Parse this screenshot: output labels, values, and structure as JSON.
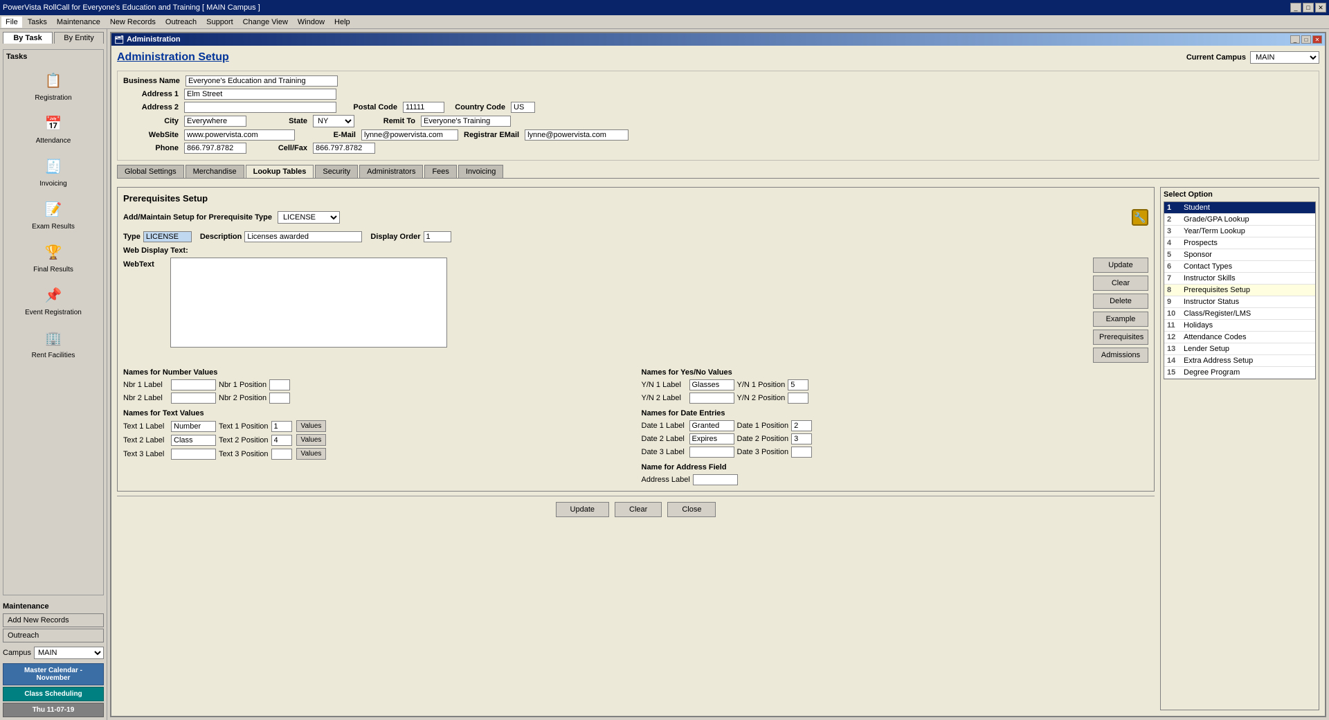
{
  "titlebar": {
    "title": "PowerVista RollCall for Everyone's Education and Training   [ MAIN Campus ]",
    "controls": [
      "minimize",
      "maximize",
      "close"
    ]
  },
  "menubar": {
    "items": [
      "File",
      "Tasks",
      "Maintenance",
      "New Records",
      "Outreach",
      "Support",
      "Change View",
      "Window",
      "Help"
    ]
  },
  "sidebar": {
    "tab1": "By Task",
    "tab2": "By Entity",
    "tasks_label": "Tasks",
    "tasks": [
      {
        "id": "registration",
        "label": "Registration",
        "icon": "📋"
      },
      {
        "id": "attendance",
        "label": "Attendance",
        "icon": "📅"
      },
      {
        "id": "invoicing",
        "label": "Invoicing",
        "icon": "🧾"
      },
      {
        "id": "exam-results",
        "label": "Exam Results",
        "icon": "📝"
      },
      {
        "id": "final-results",
        "label": "Final Results",
        "icon": "🏆"
      },
      {
        "id": "event-registration",
        "label": "Event\nRegistration",
        "icon": "📌"
      },
      {
        "id": "rent-facilities",
        "label": "Rent Facilities",
        "icon": "🏢"
      }
    ],
    "maintenance_label": "Maintenance",
    "add_new_records": "Add New Records",
    "outreach": "Outreach",
    "campus_label": "Campus",
    "campus_value": "MAIN",
    "bottom_buttons": [
      {
        "id": "master-calendar",
        "label": "Master Calendar - November",
        "color": "blue"
      },
      {
        "id": "class-scheduling",
        "label": "Class Scheduling",
        "color": "teal"
      },
      {
        "id": "date",
        "label": "Thu 11-07-19",
        "color": "gray"
      }
    ]
  },
  "window": {
    "title": "Administration",
    "controls": [
      "minimize",
      "restore",
      "close"
    ]
  },
  "header": {
    "page_title": "Administration Setup",
    "current_campus_label": "Current Campus",
    "current_campus_value": "MAIN"
  },
  "form": {
    "business_name_label": "Business Name",
    "business_name_value": "Everyone's Education and Training",
    "address1_label": "Address 1",
    "address1_value": "Elm Street",
    "address2_label": "Address 2",
    "address2_value": "",
    "postal_code_label": "Postal Code",
    "postal_code_value": "11111",
    "country_code_label": "Country Code",
    "country_code_value": "US",
    "city_label": "City",
    "city_value": "Everywhere",
    "state_label": "State",
    "state_value": "NY",
    "website_label": "WebSite",
    "website_value": "www.powervista.com",
    "email_label": "E-Mail",
    "email_value": "lynne@powervista.com",
    "registrar_email_label": "Registrar EMail",
    "registrar_email_value": "lynne@powervista.com",
    "phone_label": "Phone",
    "phone_value": "866.797.8782",
    "cellfax_label": "Cell/Fax",
    "cellfax_value": "866.797.8782",
    "remit_to_label": "Remit To",
    "remit_to_value": "Everyone's Training"
  },
  "tabs": {
    "items": [
      "Global Settings",
      "Merchandise",
      "Lookup Tables",
      "Security",
      "Administrators",
      "Fees",
      "Invoicing"
    ],
    "active": "Lookup Tables"
  },
  "prereq_section": {
    "title": "Prerequisites Setup",
    "maintain_label": "Add/Maintain Setup for Prerequisite Type",
    "type_select_value": "LICENSE",
    "type_label": "Type",
    "type_value": "LICENSE",
    "description_label": "Description",
    "description_value": "Licenses awarded",
    "display_order_label": "Display Order",
    "display_order_value": "1",
    "web_display_label": "Web Display Text:",
    "webtext_label": "WebText",
    "webtext_value": ""
  },
  "action_buttons": {
    "update": "Update",
    "clear": "Clear",
    "delete": "Delete",
    "example": "Example",
    "prerequisites": "Prerequisites",
    "admissions": "Admissions"
  },
  "names_number": {
    "title": "Names for Number Values",
    "nbr1_label": "Nbr 1 Label",
    "nbr1_value": "",
    "nbr1_pos_label": "Nbr 1 Position",
    "nbr1_pos_value": "",
    "nbr2_label": "Nbr 2 Label",
    "nbr2_value": "",
    "nbr2_pos_label": "Nbr 2 Position",
    "nbr2_pos_value": ""
  },
  "names_yesno": {
    "title": "Names for Yes/No Values",
    "yn1_label": "Y/N 1 Label",
    "yn1_value": "Glasses",
    "yn1_pos_label": "Y/N 1 Position",
    "yn1_pos_value": "5",
    "yn2_label": "Y/N 2 Label",
    "yn2_value": "",
    "yn2_pos_label": "Y/N 2 Position",
    "yn2_pos_value": ""
  },
  "names_text": {
    "title": "Names for Text Values",
    "text1_label": "Text 1 Label",
    "text1_value": "Number",
    "text1_pos_label": "Text 1 Position",
    "text1_pos_value": "1",
    "text2_label": "Text 2 Label",
    "text2_value": "Class",
    "text2_pos_label": "Text 2 Position",
    "text2_pos_value": "4",
    "text3_label": "Text 3 Label",
    "text3_value": "",
    "text3_pos_label": "Text 3 Position",
    "text3_pos_value": ""
  },
  "names_date": {
    "title": "Names for Date Entries",
    "date1_label": "Date 1 Label",
    "date1_value": "Granted",
    "date1_pos_label": "Date 1 Position",
    "date1_pos_value": "2",
    "date2_label": "Date 2 Label",
    "date2_value": "Expires",
    "date2_pos_label": "Date 2 Position",
    "date2_pos_value": "3",
    "date3_label": "Date 3 Label",
    "date3_value": "",
    "date3_pos_label": "Date 3 Position",
    "date3_pos_value": ""
  },
  "address_field": {
    "title": "Name for Address Field",
    "address_label": "Address Label",
    "address_value": ""
  },
  "select_option": {
    "title": "Select Option",
    "items": [
      {
        "num": 1,
        "label": "Student",
        "active": true
      },
      {
        "num": 2,
        "label": "Grade/GPA Lookup"
      },
      {
        "num": 3,
        "label": "Year/Term Lookup"
      },
      {
        "num": 4,
        "label": "Prospects"
      },
      {
        "num": 5,
        "label": "Sponsor"
      },
      {
        "num": 6,
        "label": "Contact Types"
      },
      {
        "num": 7,
        "label": "Instructor Skills"
      },
      {
        "num": 8,
        "label": "Prerequisites Setup",
        "highlighted": true
      },
      {
        "num": 9,
        "label": "Instructor Status"
      },
      {
        "num": 10,
        "label": "Class/Register/LMS"
      },
      {
        "num": 11,
        "label": "Holidays"
      },
      {
        "num": 12,
        "label": "Attendance Codes"
      },
      {
        "num": 13,
        "label": "Lender Setup"
      },
      {
        "num": 14,
        "label": "Extra Address Setup"
      },
      {
        "num": 15,
        "label": "Degree Program"
      }
    ]
  },
  "bottom_buttons": {
    "update": "Update",
    "clear": "Clear",
    "close": "Close"
  },
  "values_btn": "Values"
}
